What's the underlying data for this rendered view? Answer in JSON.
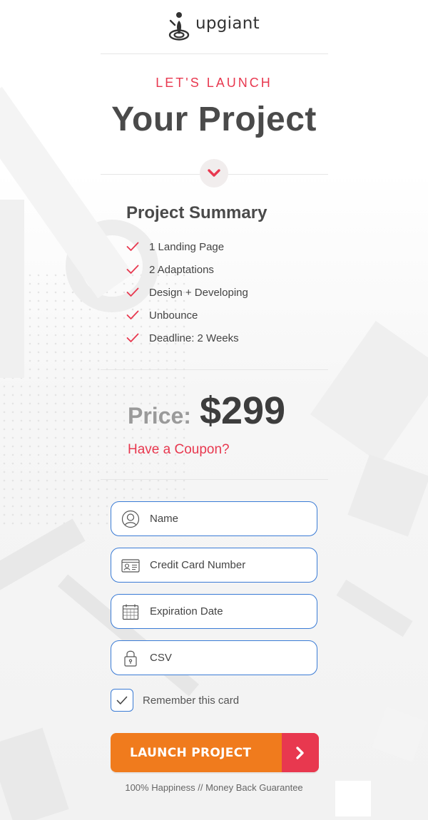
{
  "brand": {
    "name": "upgiant"
  },
  "hero": {
    "eyebrow": "LET'S LAUNCH",
    "headline": "Your Project"
  },
  "summary": {
    "title": "Project Summary",
    "items": [
      {
        "label": "1 Landing Page"
      },
      {
        "label": "2 Adaptations"
      },
      {
        "label": "Design + Developing"
      },
      {
        "label": "Unbounce"
      },
      {
        "label": "Deadline: 2 Weeks"
      }
    ]
  },
  "pricing": {
    "label": "Price:",
    "value": "$299",
    "coupon_link": "Have a Coupon?"
  },
  "form": {
    "name_placeholder": "Name",
    "card_placeholder": "Credit Card Number",
    "expiry_placeholder": "Expiration Date",
    "csv_placeholder": "CSV",
    "remember_label": "Remember this card",
    "remember_checked": true,
    "submit_label": "LAUNCH PROJECT"
  },
  "footer": {
    "guarantee": "100% Happiness  //  Money Back Guarantee"
  },
  "icons": {
    "chevron": "chevron-down-icon",
    "check": "check-icon",
    "user": "user-icon",
    "card": "id-card-icon",
    "calendar": "calendar-icon",
    "lock": "lock-icon",
    "arrow": "chevron-right-icon"
  },
  "colors": {
    "accent_red": "#e8384f",
    "cta_orange": "#f07b1d",
    "field_border": "#3a7bd5",
    "heading": "#4a4a4a"
  }
}
